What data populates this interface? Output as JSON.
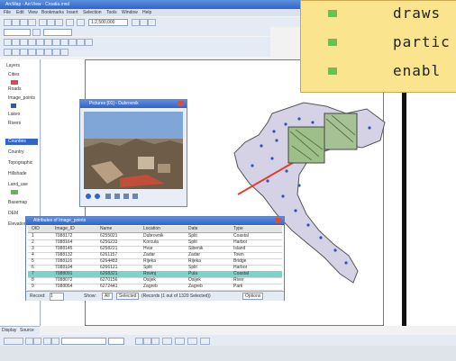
{
  "window": {
    "title": "ArcMap - ArcView - Croatia.mxd",
    "menu": [
      "File",
      "Edit",
      "View",
      "Bookmarks",
      "Insert",
      "Selection",
      "Tools",
      "Window",
      "Help"
    ],
    "scale": "1:2,500,000"
  },
  "toc": {
    "items": [
      "Layers",
      "Cities",
      "Roads",
      "Image_points",
      "Lakes",
      "Rivers",
      "Counties",
      "Country",
      "Topographic",
      "Hillshade",
      "Land_use",
      "Basemap",
      "DEM",
      "Elevation"
    ]
  },
  "callout": {
    "items": [
      "draws",
      "partic",
      "enabl"
    ]
  },
  "photo_window": {
    "title": "Pictures [01] - Dubrovnik"
  },
  "table": {
    "title": "Attributes of Image_points",
    "headers": [
      "OID",
      "Image_ID",
      "Name",
      "Location",
      "Date",
      "Type"
    ],
    "rows": [
      [
        "1",
        "7088172",
        "6255021",
        "Dubrovnik",
        "Split",
        "Coastal"
      ],
      [
        "2",
        "7088164",
        "6256233",
        "Korcula",
        "Split",
        "Harbor"
      ],
      [
        "3",
        "7088145",
        "6258221",
        "Hvar",
        "Sibenik",
        "Island"
      ],
      [
        "4",
        "7088132",
        "6261157",
        "Zadar",
        "Zadar",
        "Town"
      ],
      [
        "5",
        "7088116",
        "6264483",
        "Rijeka",
        "Rijeka",
        "Bridge"
      ],
      [
        "6",
        "7088104",
        "6266121",
        "Split",
        "Split",
        "Harbor"
      ],
      [
        "7",
        "7088091",
        "6268321",
        "Rovinj",
        "Pula",
        "Coastal"
      ],
      [
        "8",
        "7088072",
        "6270156",
        "Osijek",
        "Osijek",
        "River"
      ],
      [
        "9",
        "7088064",
        "6272441",
        "Zagreb",
        "Zagreb",
        "Park"
      ]
    ],
    "highlighted_row": 6,
    "footer": {
      "record_label": "Record:",
      "record_value": "1",
      "show_label": "Show:",
      "show_all": "All",
      "show_selected": "Selected",
      "status": "(Records (1 out of 1320 Selected))",
      "options": "Options"
    }
  },
  "bottom_tabs": [
    "Display",
    "Source"
  ],
  "colors": {
    "accent": "#2f64c8",
    "map_fill": "#d6d2e6",
    "highlight": "#7dd3c7",
    "callout_bg": "#fae58e",
    "bullet": "#69c24f",
    "point": "#2f55b5"
  }
}
